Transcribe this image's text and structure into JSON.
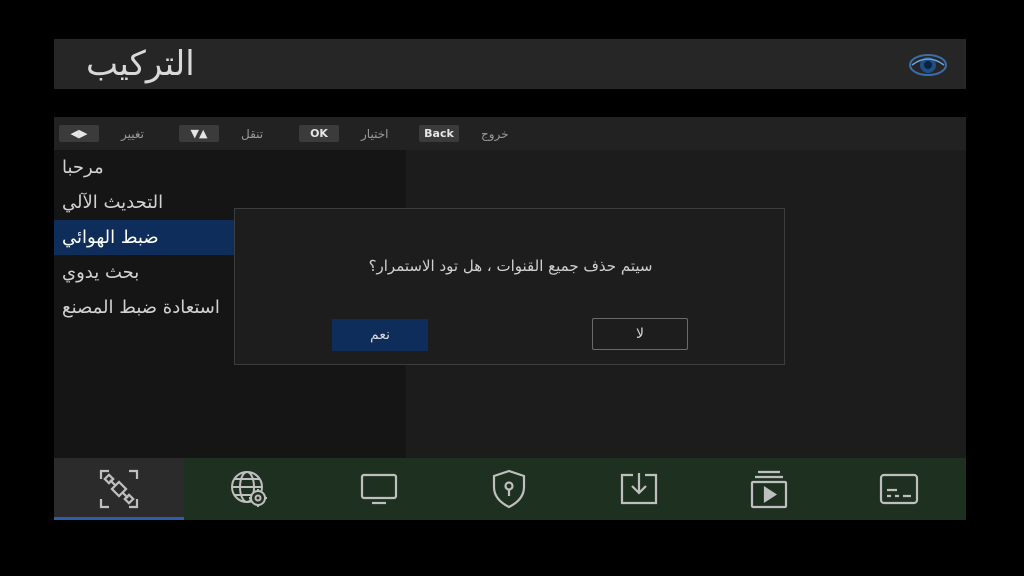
{
  "header": {
    "title": "التركيب",
    "logo_icon": "eye-logo-icon"
  },
  "hints": [
    {
      "key": "◀▶",
      "label": "تغيير"
    },
    {
      "key": "▼▲",
      "label": "تنقل"
    },
    {
      "key": "OK",
      "label": "اختيار"
    },
    {
      "key": "Back",
      "label": "خروج"
    }
  ],
  "menu": {
    "items": [
      {
        "label": "مرحبا"
      },
      {
        "label": "التحديث الآلي"
      },
      {
        "label": "ضبط الهوائي",
        "selected": true
      },
      {
        "label": "بحث يدوي"
      },
      {
        "label": "استعادة ضبط المصنع"
      }
    ]
  },
  "dialog": {
    "message": "سيتم حذف جميع القنوات ، هل تود الاستمرار؟",
    "yes_label": "نعم",
    "no_label": "لا"
  },
  "bottom_tabs": [
    {
      "icon": "satellite-icon",
      "active": true
    },
    {
      "icon": "network-settings-icon"
    },
    {
      "icon": "tv-icon"
    },
    {
      "icon": "security-shield-icon"
    },
    {
      "icon": "download-icon"
    },
    {
      "icon": "media-player-icon"
    },
    {
      "icon": "subtitles-icon"
    }
  ],
  "colors": {
    "accent": "#0f2d5a",
    "tab_underline": "#2d5fa8",
    "bottom_bar": "#1e3020"
  }
}
